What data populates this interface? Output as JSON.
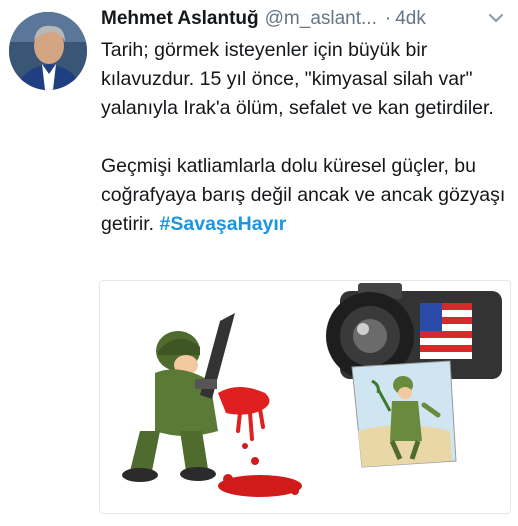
{
  "tweet": {
    "author_name": "Mehmet Aslantuğ",
    "handle": "@m_aslant...",
    "separator": "·",
    "time": "4dk",
    "paragraph1": "Tarih; görmek isteyenler için büyük bir kılavuzdur. 15 yıl önce, \"kimyasal silah var\" yalanıyla Irak'a ölüm, sefalet ve kan getirdiler.",
    "paragraph2": "Geçmişi katliamlarla dolu küresel güçler, bu coğrafyaya barış değil ancak ve ancak gözyaşı getirir.",
    "hashtag": "#SavaşaHayır"
  },
  "icons": {
    "menu": "chevron-down-icon",
    "avatar": "avatar"
  },
  "colors": {
    "hashtag": "#1b95e0",
    "secondary_text": "#657786",
    "primary_text": "#14171a"
  }
}
